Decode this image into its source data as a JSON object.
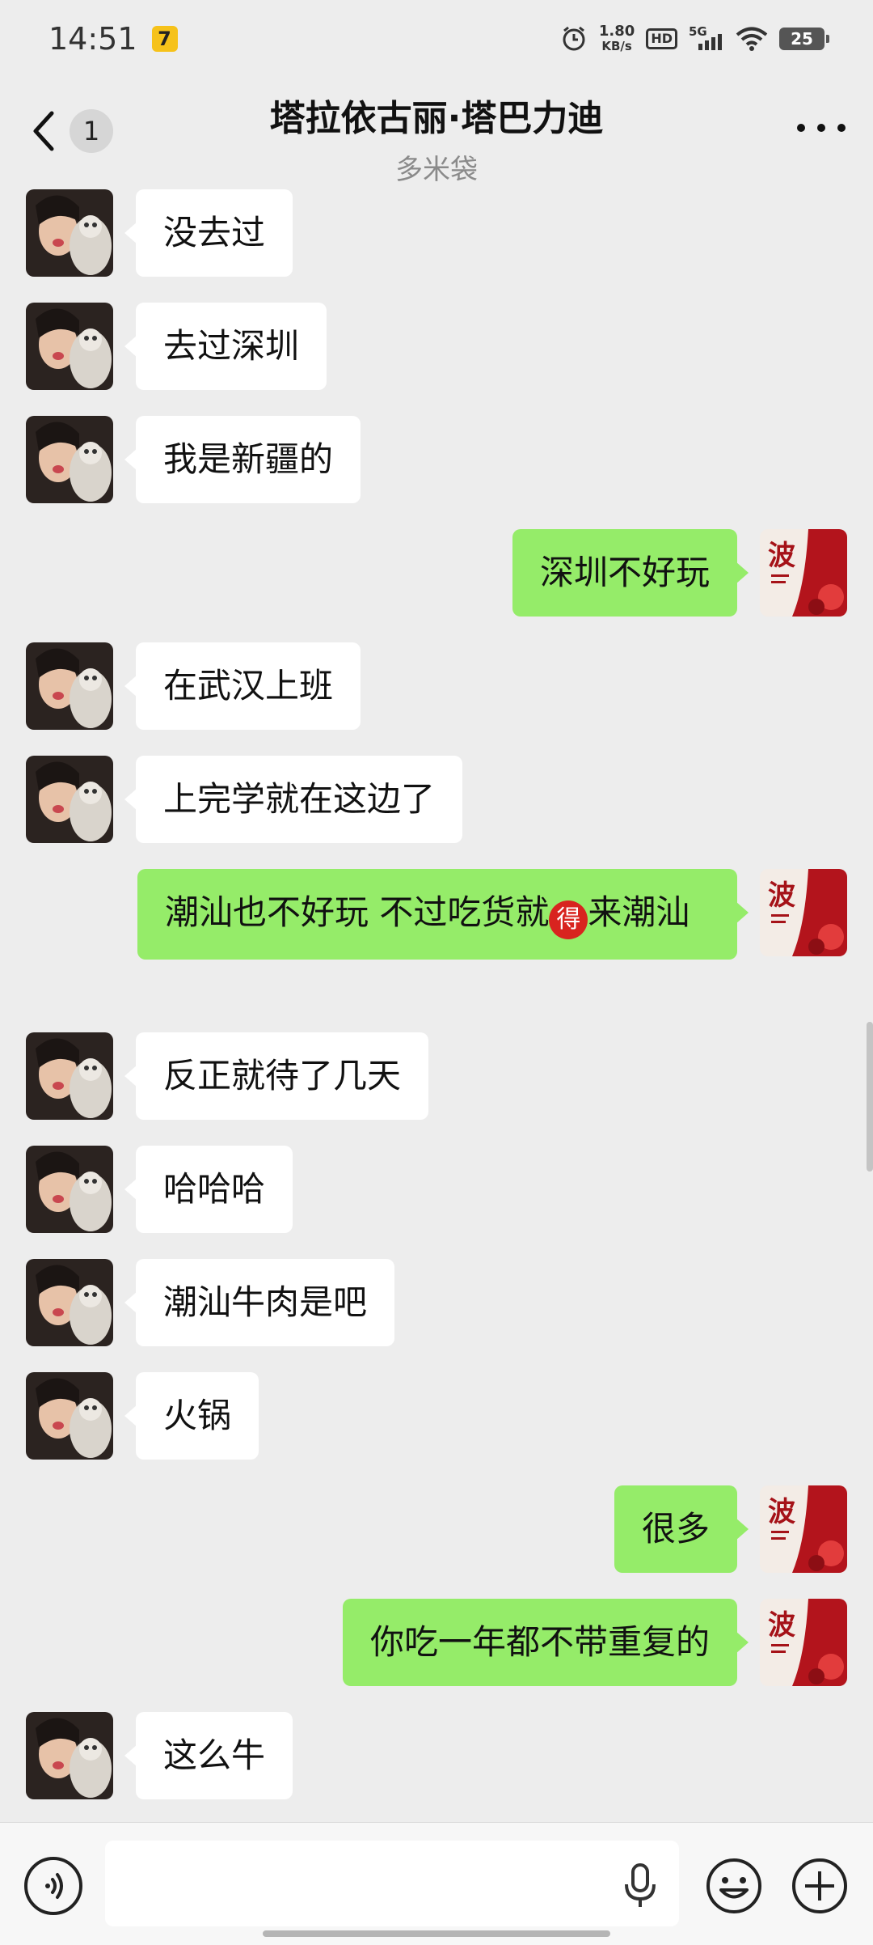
{
  "status_bar": {
    "time": "14:51",
    "net_speed_value": "1.80",
    "net_speed_unit": "KB/s",
    "hd_label": "HD",
    "network_label": "5G",
    "battery": "25"
  },
  "header": {
    "unread_count": "1",
    "title": "塔拉依古丽·塔巴力迪",
    "subtitle": "多米袋"
  },
  "messages": [
    {
      "from": "her",
      "text": "没去过"
    },
    {
      "from": "her",
      "text": "去过深圳"
    },
    {
      "from": "her",
      "text": "我是新疆的"
    },
    {
      "from": "me",
      "text": "深圳不好玩"
    },
    {
      "from": "her",
      "text": "在武汉上班"
    },
    {
      "from": "her",
      "text": "上完学就在这边了"
    },
    {
      "from": "me",
      "text_before": "潮汕也不好玩 不过吃货就",
      "emoji": "得",
      "text_after": "来潮汕"
    },
    {
      "from": "her",
      "text": "反正就待了几天"
    },
    {
      "from": "her",
      "text": "哈哈哈"
    },
    {
      "from": "her",
      "text": "潮汕牛肉是吧"
    },
    {
      "from": "her",
      "text": "火锅"
    },
    {
      "from": "me",
      "text": "很多"
    },
    {
      "from": "me",
      "text": "你吃一年都不带重复的"
    },
    {
      "from": "her",
      "text": "这么牛"
    }
  ],
  "avatars": {
    "me_text": "波"
  },
  "colors": {
    "background": "#ededed",
    "outgoing_bubble": "#95ec69",
    "incoming_bubble": "#ffffff",
    "emoji_red": "#d8241f"
  },
  "icons": {
    "back": "chevron-left-icon",
    "more": "more-dots-icon",
    "voice": "voice-icon",
    "mic": "microphone-icon",
    "emoji": "emoji-icon",
    "add": "plus-icon"
  },
  "input": {
    "value": "",
    "placeholder": ""
  }
}
